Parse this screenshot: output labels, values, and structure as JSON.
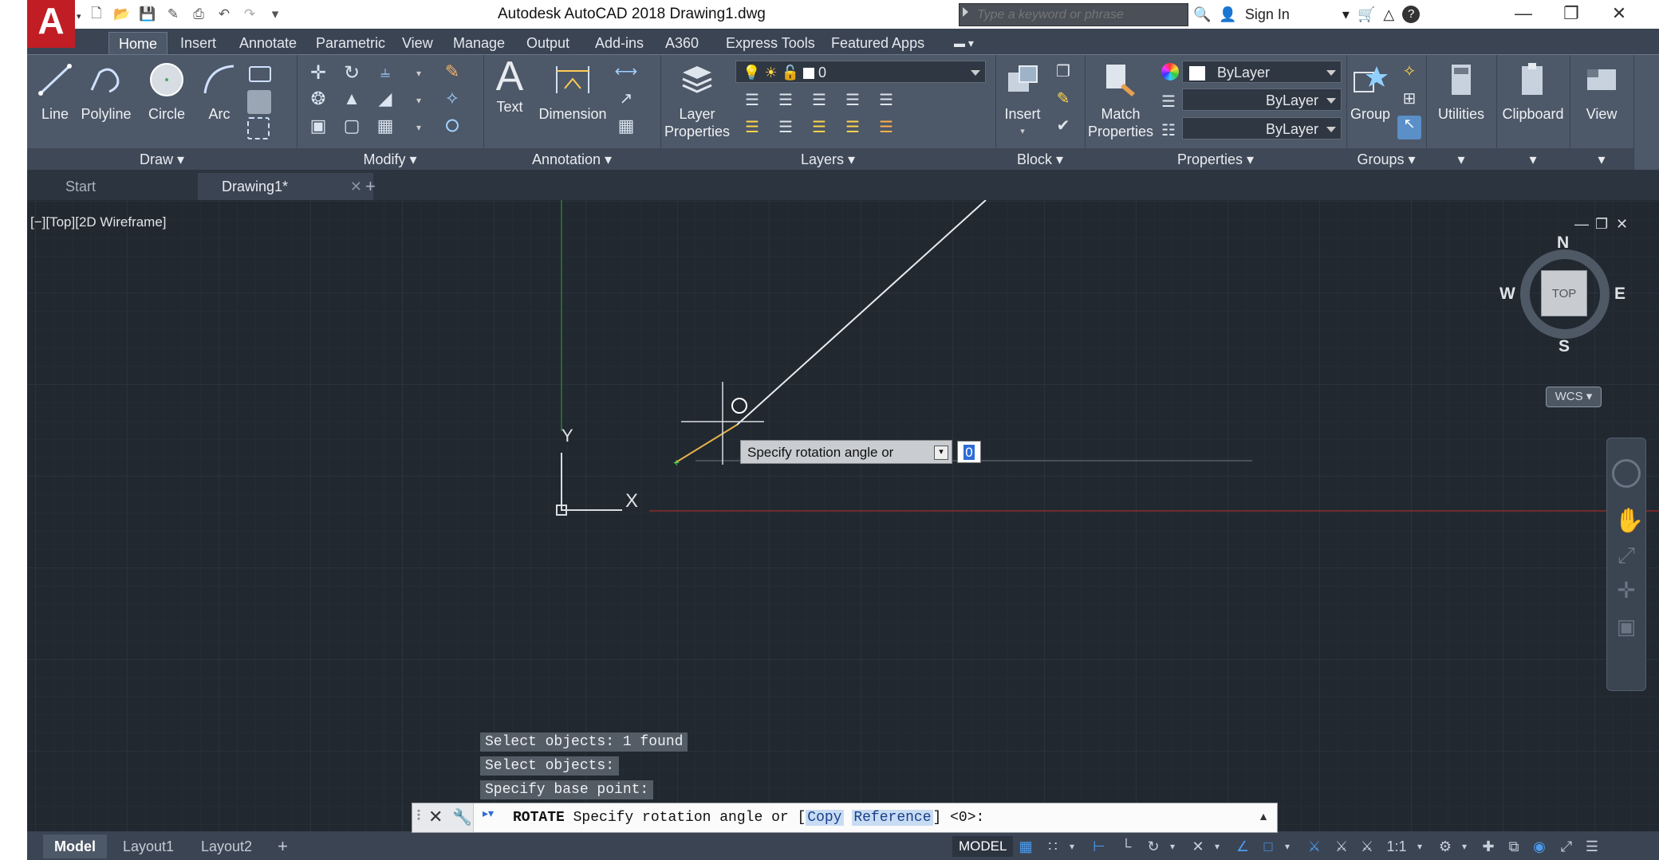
{
  "titlebar": {
    "app_title": "Autodesk AutoCAD 2018    Drawing1.dwg",
    "search_placeholder": "Type a keyword or phrase",
    "sign_in": "Sign In"
  },
  "ribbon_tabs": [
    "Home",
    "Insert",
    "Annotate",
    "Parametric",
    "View",
    "Manage",
    "Output",
    "Add-ins",
    "A360",
    "Express Tools",
    "Featured Apps"
  ],
  "ribbon": {
    "draw": {
      "title": "Draw",
      "buttons": [
        "Line",
        "Polyline",
        "Circle",
        "Arc"
      ]
    },
    "modify": {
      "title": "Modify"
    },
    "annotation": {
      "title": "Annotation",
      "buttons": [
        "Text",
        "Dimension"
      ]
    },
    "layers": {
      "title": "Layers",
      "layer_props_1": "Layer",
      "layer_props_2": "Properties",
      "current_layer": "0"
    },
    "block": {
      "title": "Block",
      "insert": "Insert"
    },
    "properties": {
      "title": "Properties",
      "match_1": "Match",
      "match_2": "Properties",
      "color": "ByLayer",
      "linetype": "ByLayer",
      "lineweight": "ByLayer"
    },
    "groups": {
      "title": "Groups",
      "group": "Group"
    },
    "utilities": "Utilities",
    "clipboard": "Clipboard",
    "view": "View"
  },
  "doc_tabs": {
    "start": "Start",
    "drawing": "Drawing1*"
  },
  "viewport": {
    "label": "[−][Top][2D Wireframe]",
    "compass": {
      "n": "N",
      "s": "S",
      "e": "E",
      "w": "W",
      "top": "TOP"
    },
    "wcs": "WCS",
    "axis_y": "Y",
    "axis_x": "X"
  },
  "dynamic_input": {
    "prompt": "Specify rotation angle or",
    "value": "0"
  },
  "command_history": [
    "Select objects: 1 found",
    "Select objects:",
    "Specify base point:"
  ],
  "command_line": {
    "command": "ROTATE",
    "prompt": "Specify rotation angle or [",
    "opt1": "Copy",
    "opt2": "Reference",
    "tail": "] <0>:"
  },
  "layout_tabs": [
    "Model",
    "Layout1",
    "Layout2"
  ],
  "status": {
    "model": "MODEL",
    "scale": "1:1"
  },
  "colors": {
    "accent": "#c01e24",
    "canvas": "#212830",
    "ribbon": "#4d5868"
  }
}
